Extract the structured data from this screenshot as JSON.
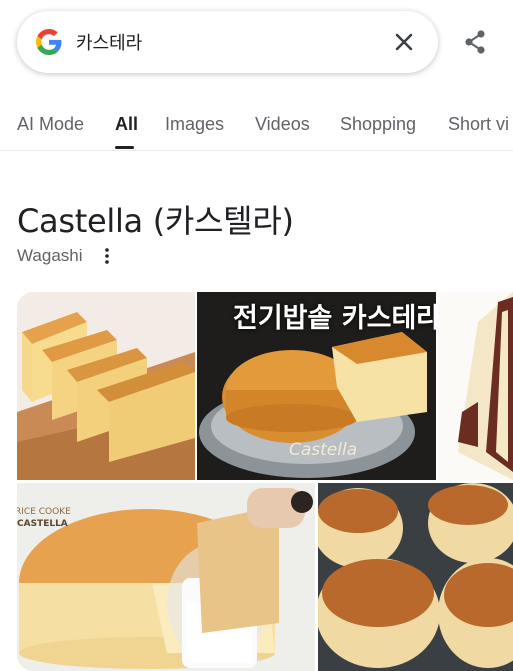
{
  "search": {
    "query": "카스테라",
    "placeholder": "Search"
  },
  "icons": {
    "logo": "google-g-icon",
    "clear": "close-icon",
    "share": "share-icon",
    "more": "more-vertical-icon"
  },
  "tabs": [
    {
      "label": "AI Mode",
      "active": false
    },
    {
      "label": "All",
      "active": true
    },
    {
      "label": "Images",
      "active": false
    },
    {
      "label": "Videos",
      "active": false
    },
    {
      "label": "Shopping",
      "active": false
    },
    {
      "label": "Short vi",
      "active": false
    }
  ],
  "knowledge_panel": {
    "title": "Castella (카스텔라)",
    "subtitle": "Wagashi"
  },
  "images": {
    "tile2_caption_korean": "전기밥솥 카스테라",
    "tile2_watermark": "Castella",
    "tile4_caption_top": "RICE COOKE",
    "tile4_caption_bottom": "CASTELLA"
  },
  "colors": {
    "text_primary": "#202124",
    "text_secondary": "#5f6368",
    "google_blue": "#4285F4",
    "google_red": "#EA4335",
    "google_yellow": "#FBBC05",
    "google_green": "#34A853"
  }
}
